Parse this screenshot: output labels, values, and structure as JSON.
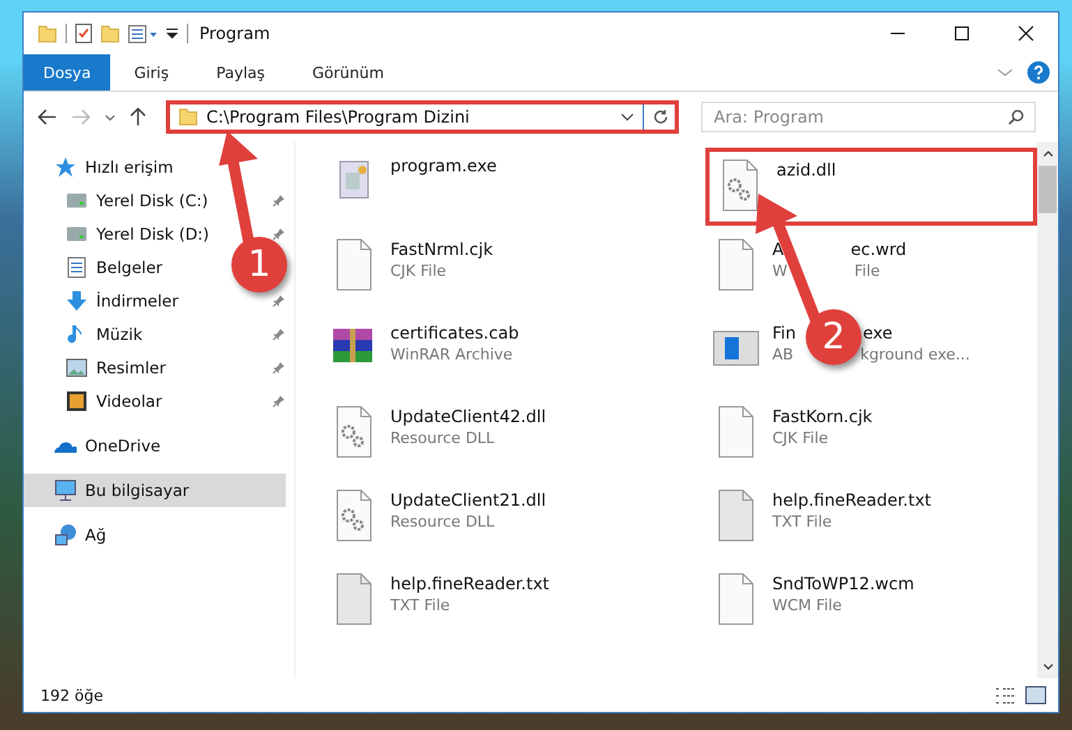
{
  "window": {
    "title": "Program"
  },
  "ribbon_tabs": [
    {
      "label": "Dosya",
      "selected": true
    },
    {
      "label": "Giriş",
      "selected": false
    },
    {
      "label": "Paylaş",
      "selected": false
    },
    {
      "label": "Görünüm",
      "selected": false
    }
  ],
  "address": {
    "path": "C:\\Program Files\\Program Dizini",
    "highlighted": true
  },
  "search": {
    "placeholder": "Ara: Program"
  },
  "sidebar": {
    "items": [
      {
        "label": "Hızlı erişim",
        "kind": "star",
        "pinned": false,
        "selected": false,
        "children": [
          {
            "label": "Yerel Disk (C:)",
            "kind": "disk",
            "pinned": true,
            "selected": false
          },
          {
            "label": "Yerel Disk (D:)",
            "kind": "disk",
            "pinned": true,
            "selected": false
          },
          {
            "label": "Belgeler",
            "kind": "doc",
            "pinned": false,
            "selected": false
          },
          {
            "label": "İndirmeler",
            "kind": "download",
            "pinned": true,
            "selected": false
          },
          {
            "label": "Müzik",
            "kind": "music",
            "pinned": true,
            "selected": false
          },
          {
            "label": "Resimler",
            "kind": "picture",
            "pinned": true,
            "selected": false
          },
          {
            "label": "Videolar",
            "kind": "video",
            "pinned": true,
            "selected": false
          }
        ]
      },
      {
        "label": "OneDrive",
        "kind": "cloud",
        "pinned": false,
        "selected": false
      },
      {
        "label": "Bu bilgisayar",
        "kind": "pc",
        "pinned": false,
        "selected": true
      },
      {
        "label": "Ağ",
        "kind": "network",
        "pinned": false,
        "selected": false
      }
    ]
  },
  "files": [
    {
      "name": "program.exe",
      "kind": "exe",
      "highlighted": false
    },
    {
      "name": "azid.dll",
      "kind": "dll",
      "highlighted": true
    },
    {
      "name": "FastNrml.cjk",
      "type": "CJK File",
      "kind": "blank",
      "highlighted": false
    },
    {
      "name": "A",
      "name_end": "ec.wrd",
      "type": "W",
      "type_end": "File",
      "kind": "blank",
      "highlighted": false
    },
    {
      "name": "certificates.cab",
      "type": "WinRAR Archive",
      "kind": "rar",
      "highlighted": false
    },
    {
      "name": "Fin",
      "name_end": "exe",
      "type": "AB",
      "type_end": "kground exe...",
      "kind": "app",
      "highlighted": false
    },
    {
      "name": "UpdateClient42.dll",
      "type": "Resource DLL",
      "kind": "dll",
      "highlighted": false
    },
    {
      "name": "FastKorn.cjk",
      "type": "CJK File",
      "kind": "blank",
      "highlighted": false
    },
    {
      "name": "UpdateClient21.dll",
      "type": "Resource DLL",
      "kind": "dll",
      "highlighted": false
    },
    {
      "name": "help.fineReader.txt",
      "type": "TXT File",
      "kind": "text",
      "highlighted": false
    },
    {
      "name": "help.fineReader.txt",
      "type": "TXT File",
      "kind": "text",
      "highlighted": false
    },
    {
      "name": "SndToWP12.wcm",
      "type": "WCM File",
      "kind": "blank",
      "highlighted": false
    }
  ],
  "callouts": [
    {
      "number": "1"
    },
    {
      "number": "2"
    }
  ],
  "status_bar": {
    "count": "192 öğe"
  }
}
